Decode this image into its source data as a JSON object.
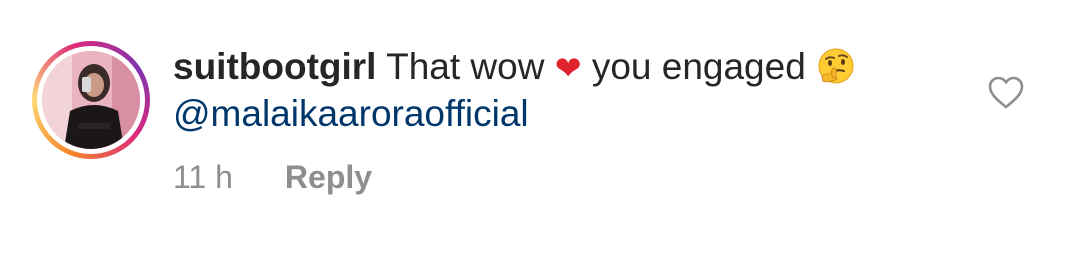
{
  "comment": {
    "username": "suitbootgirl",
    "text_before": "That wow",
    "heart_emoji": "❤",
    "text_after": "you engaged",
    "thinking_emoji": "thinking-face-emoji",
    "mention": "@malaikaaroraofficial",
    "timestamp": "11 h",
    "reply_label": "Reply",
    "like_icon": "heart-outline-icon"
  },
  "colors": {
    "username": "#262626",
    "mention": "#00376b",
    "meta": "#8e8e8e",
    "heart": "#e0242e"
  }
}
